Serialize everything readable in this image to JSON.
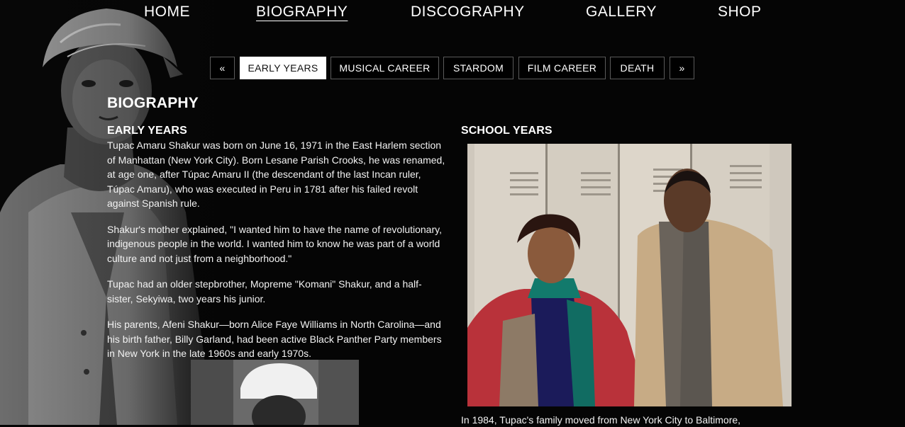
{
  "nav": {
    "items": [
      "HOME",
      "BIOGRAPHY",
      "DISCOGRAPHY",
      "GALLERY",
      "SHOP"
    ],
    "active": "BIOGRAPHY"
  },
  "subnav": {
    "prev": "«",
    "next": "»",
    "tabs": [
      "EARLY YEARS",
      "MUSICAL CAREER",
      "STARDOM",
      "FILM CAREER",
      "DEATH"
    ],
    "active": "EARLY YEARS"
  },
  "page": {
    "title": "BIOGRAPHY"
  },
  "early_years": {
    "heading": "EARLY YEARS",
    "paragraphs": [
      "Tupac Amaru Shakur was born on June 16, 1971 in the East Harlem section of Manhattan (New York City). Born Lesane Parish Crooks, he was renamed, at age one, after Túpac Amaru II (the descendant of the last Incan ruler, Túpac Amaru), who was executed in Peru in 1781 after his failed revolt against Spanish rule.",
      "Shakur's mother explained, \"I wanted him to have the name of revolutionary, indigenous people in the world. I wanted him to know he was part of a world culture and not just from a neighborhood.\"",
      "Tupac had an older stepbrother, Mopreme \"Komani\" Shakur, and a half-sister, Sekyiwa, two years his junior.",
      "His parents, Afeni Shakur—born Alice Faye Williams in North Carolina—and his birth father, Billy Garland, had been active Black Panther Party members in New York in the late 1960s and early 1970s."
    ]
  },
  "school_years": {
    "heading": "SCHOOL YEARS",
    "text": "In 1984, Tupac's family moved from New York City to Baltimore,"
  },
  "colors": {
    "background": "#050505",
    "text": "#ffffff",
    "border": "#5a5a5a"
  }
}
